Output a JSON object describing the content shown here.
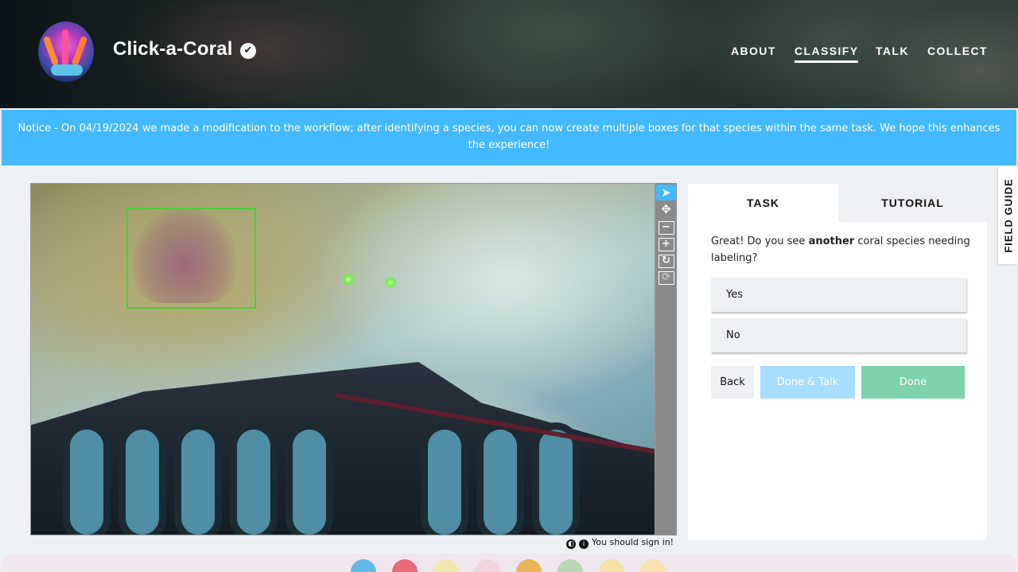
{
  "header": {
    "site_title": "Click-a-Coral",
    "verified_glyph": "✔",
    "nav": [
      {
        "label": "ABOUT",
        "active": false
      },
      {
        "label": "CLASSIFY",
        "active": true
      },
      {
        "label": "TALK",
        "active": false
      },
      {
        "label": "COLLECT",
        "active": false
      }
    ]
  },
  "notice": {
    "text": "Notice - On 04/19/2024 we made a modification to the workflow; after identifying a species, you can now create multiple boxes for that species within the same task. We hope this enhances the experience!"
  },
  "viewer": {
    "toolbar": [
      {
        "name": "annotate-tool",
        "icon": "cursor-icon",
        "glyph": "➤",
        "active": true
      },
      {
        "name": "move-tool",
        "icon": "move-icon",
        "glyph": "✥",
        "active": false
      },
      {
        "name": "zoom-out-tool",
        "icon": "minus-icon",
        "glyph": "−",
        "active": false
      },
      {
        "name": "zoom-in-tool",
        "icon": "plus-icon",
        "glyph": "+",
        "active": false
      },
      {
        "name": "rotate-tool",
        "icon": "rotate-icon",
        "glyph": "↻",
        "active": false
      },
      {
        "name": "reset-tool",
        "icon": "reset-icon",
        "glyph": "⟳",
        "active": false
      }
    ],
    "footer_text": "You should sign in!"
  },
  "task_panel": {
    "tabs": [
      {
        "label": "TASK",
        "active": true
      },
      {
        "label": "TUTORIAL",
        "active": false
      }
    ],
    "question_prefix": "Great! Do you see ",
    "question_emphasis": "another",
    "question_suffix": " coral species needing labeling?",
    "answers": [
      "Yes",
      "No"
    ],
    "buttons": {
      "back": "Back",
      "done_talk": "Done & Talk",
      "done": "Done"
    }
  },
  "field_guide": {
    "label": "FIELD GUIDE"
  },
  "colors": {
    "notice_bg": "#43b9ff",
    "mark_box": "#48cf3c",
    "done_button": "#7ed1ad",
    "done_talk_button": "#a6dcfd"
  }
}
